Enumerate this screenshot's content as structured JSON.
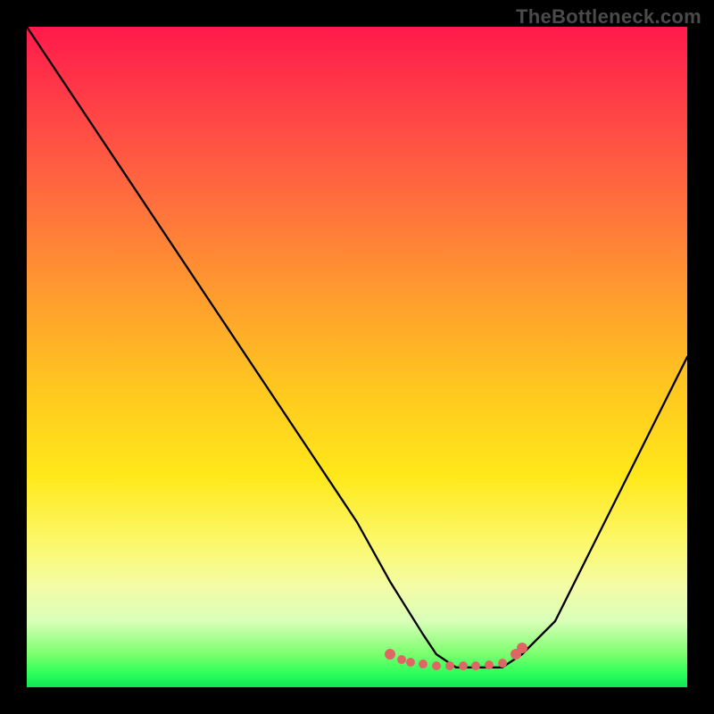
{
  "watermark": "TheBottleneck.com",
  "chart_data": {
    "type": "line",
    "title": "",
    "xlabel": "",
    "ylabel": "",
    "xlim": [
      0,
      100
    ],
    "ylim": [
      0,
      100
    ],
    "series": [
      {
        "name": "curve",
        "x": [
          0,
          10,
          20,
          30,
          40,
          50,
          55,
          60,
          62,
          65,
          70,
          72,
          75,
          80,
          85,
          90,
          95,
          100
        ],
        "values": [
          100,
          85,
          70,
          55,
          40,
          25,
          16,
          8,
          5,
          3,
          3,
          3,
          5,
          10,
          20,
          30,
          40,
          50
        ]
      },
      {
        "name": "dots",
        "x": [
          55,
          58,
          60,
          62,
          64,
          66,
          68,
          70,
          72,
          74
        ],
        "values": [
          5,
          4,
          3.5,
          3,
          3,
          3,
          3,
          3.2,
          3.5,
          5
        ]
      }
    ],
    "colors": {
      "curve": "#000000",
      "dots": "#e06666"
    }
  }
}
